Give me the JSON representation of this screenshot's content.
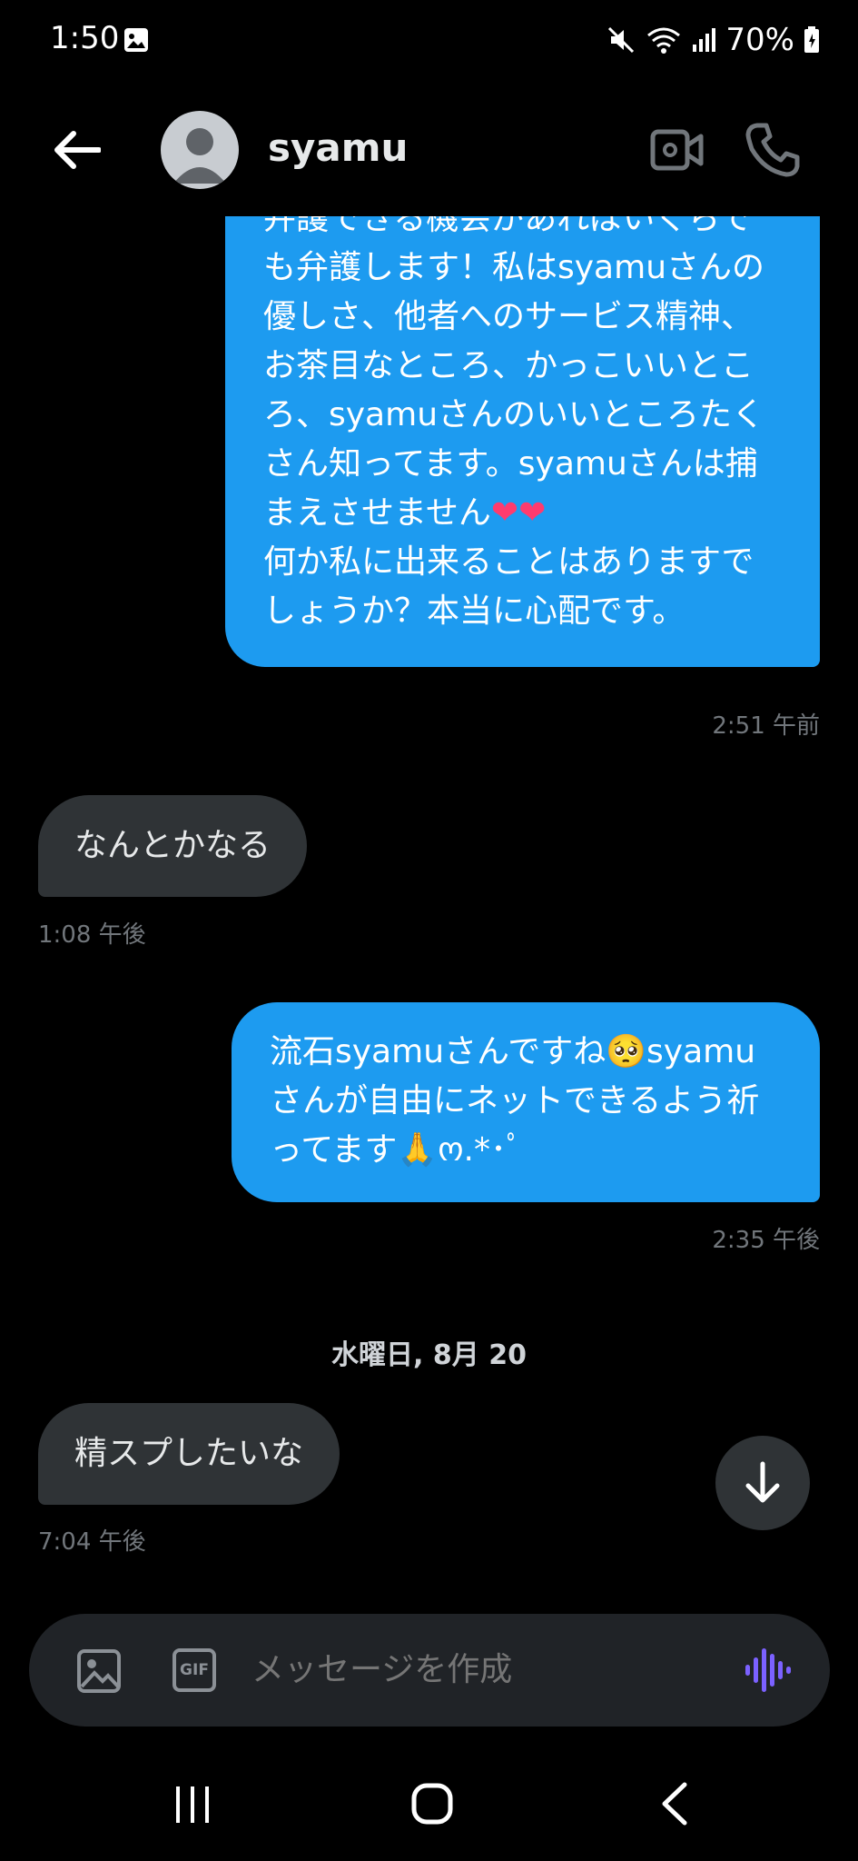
{
  "status_bar": {
    "time": "1:50",
    "battery": "70%",
    "icons": [
      "gallery-icon",
      "mute-icon",
      "wifi-icon",
      "signal-icon",
      "battery-icon"
    ]
  },
  "header": {
    "contact_name": "syamu",
    "icons": [
      "back-arrow-icon",
      "avatar",
      "video-call-icon",
      "phone-icon"
    ]
  },
  "messages": [
    {
      "direction": "outgoing",
      "lines": [
        "弁護できる機会があればいくらで",
        "も弁護します！私はsyamuさんの",
        "優しさ、他者へのサービス精神、",
        "お茶目なところ、かっこいいとこ",
        "ろ、syamuさんのいいところたく",
        "さん知ってます。syamuさんは捕",
        "まえさせません",
        "何か私に出来ることはありますで",
        "しょうか？本当に心配です。"
      ],
      "hearts": "❤❤",
      "time": "2:51 午前"
    },
    {
      "direction": "incoming",
      "text": "なんとかなる",
      "time": "1:08 午後"
    },
    {
      "direction": "outgoing",
      "lines": [
        "流石syamuさんですね🥺syamu",
        "さんが自由にネットできるよう祈",
        "ってます🙏ო.*･ﾟ"
      ],
      "time": "2:35 午後"
    },
    {
      "direction": "date",
      "text": "水曜日, 8月 20"
    },
    {
      "direction": "incoming",
      "text": "精スプしたいな",
      "time": "7:04 午後"
    }
  ],
  "composer": {
    "placeholder": "メッセージを作成",
    "gif_label": "GIF"
  },
  "colors": {
    "outgoing_bubble": "#1d9bf0",
    "incoming_bubble": "#2f3336",
    "background": "#000000",
    "voice_accent": "#7b61ff"
  }
}
